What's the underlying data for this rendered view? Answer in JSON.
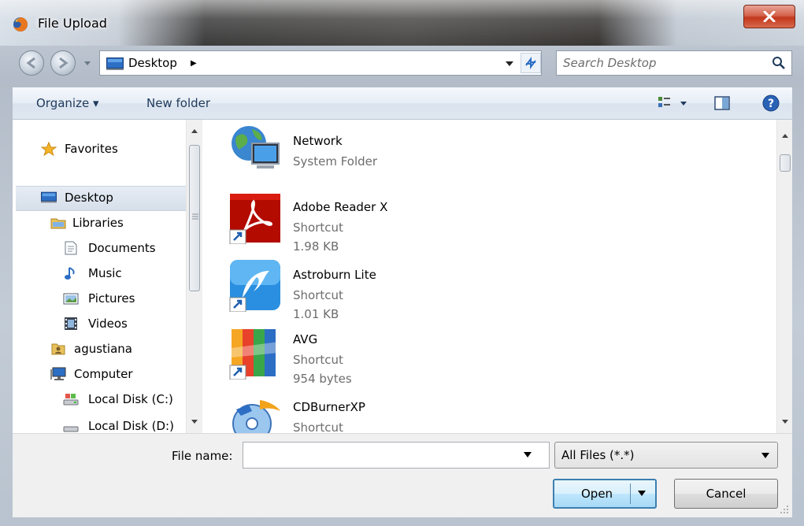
{
  "window": {
    "title": "File Upload",
    "close_glyph": "x"
  },
  "address": {
    "location": "Desktop",
    "chevron": "▶"
  },
  "search": {
    "placeholder": "Search Desktop"
  },
  "toolbar": {
    "organize_label": "Organize ▾",
    "new_folder_label": "New folder"
  },
  "nav_pane": {
    "items": [
      {
        "label": "Favorites",
        "icon": "star-icon"
      },
      {
        "label": "Desktop",
        "icon": "desktop-icon",
        "selected": true
      },
      {
        "label": "Libraries",
        "icon": "libraries-icon"
      },
      {
        "label": "Documents",
        "icon": "document-icon"
      },
      {
        "label": "Music",
        "icon": "music-note-icon"
      },
      {
        "label": "Pictures",
        "icon": "picture-icon"
      },
      {
        "label": "Videos",
        "icon": "film-icon"
      },
      {
        "label": "agustiana",
        "icon": "user-folder-icon"
      },
      {
        "label": "Computer",
        "icon": "computer-icon"
      },
      {
        "label": "Local Disk (C:)",
        "icon": "drive-icon"
      },
      {
        "label": "Local Disk (D:)",
        "icon": "drive-icon"
      }
    ]
  },
  "files": [
    {
      "name": "Network",
      "type": "System Folder",
      "size": "",
      "icon": "network-icon"
    },
    {
      "name": "Adobe Reader X",
      "type": "Shortcut",
      "size": "1.98 KB",
      "icon": "adobe-reader-icon"
    },
    {
      "name": "Astroburn Lite",
      "type": "Shortcut",
      "size": "1.01 KB",
      "icon": "astroburn-icon"
    },
    {
      "name": "AVG",
      "type": "Shortcut",
      "size": "954 bytes",
      "icon": "avg-icon"
    },
    {
      "name": "CDBurnerXP",
      "type": "Shortcut",
      "size": "",
      "icon": "cdburnerxp-icon"
    }
  ],
  "bottom": {
    "filename_label": "File name:",
    "filename_value": "",
    "filetype_value": "All Files (*.*)",
    "open_label": "Open",
    "cancel_label": "Cancel"
  },
  "colors": {
    "toolbar_text": "#1e395b",
    "close_red": "#c2371c",
    "selection": "#d6dfea",
    "open_border": "#3c7fb1"
  }
}
